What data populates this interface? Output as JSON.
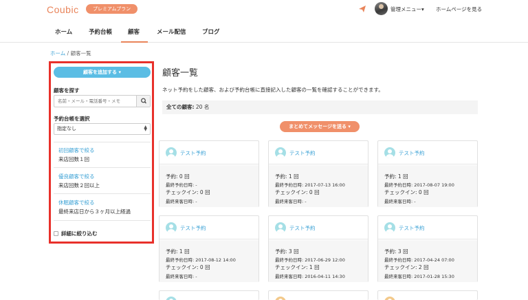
{
  "header": {
    "logo": "Coubic",
    "premium_badge": "プレミアムプラン",
    "admin_menu": "管理メニュー▾",
    "homepage_link": "ホームページを見る"
  },
  "nav": {
    "items": [
      "ホーム",
      "予約台帳",
      "顧客",
      "メール配信",
      "ブログ"
    ],
    "active": "顧客"
  },
  "breadcrumb": {
    "home": "ホーム",
    "separator": "/",
    "current": "顧客一覧"
  },
  "sidebar": {
    "add_button": "顧客を追加する ▾",
    "search_label": "顧客を探す",
    "search_placeholder": "名前・メール・電話番号・メモ",
    "ledger_label": "予約台帳を選択",
    "ledger_selected": "指定なし",
    "filters": [
      {
        "link": "初回顧客で絞る",
        "desc": "来店回数１回"
      },
      {
        "link": "優良顧客で絞る",
        "desc": "来店回数２回以上"
      },
      {
        "link": "休眠顧客で絞る",
        "desc": "最終来店日から３ヶ月以上経過"
      }
    ],
    "detail_filter": "詳細に絞り込む"
  },
  "main": {
    "title": "顧客一覧",
    "description": "ネット予約をした顧客、および予約台帳に直接記入した顧客の一覧を確認することができます。",
    "total_label": "全ての顧客:",
    "total_value": "20 名",
    "message_button": "まとめてメッセージを送る ▾"
  },
  "cards": [
    {
      "name": "テスト予約",
      "reservations": "予約: 0 回",
      "last_reservation": "最終予約日時: -",
      "checkins": "チェックイン: 0 回",
      "last_visit": "最終来客日時: -"
    },
    {
      "name": "テスト予約",
      "reservations": "予約: 1 回",
      "last_reservation": "最終予約日時: 2017-07-13 16:00",
      "checkins": "チェックイン: 0 回",
      "last_visit": "最終来客日時: -"
    },
    {
      "name": "テスト予約",
      "reservations": "予約: 1 回",
      "last_reservation": "最終予約日時: 2017-08-07 19:00",
      "checkins": "チェックイン: 0 回",
      "last_visit": "最終来客日時: -"
    },
    {
      "name": "テスト予約",
      "reservations": "予約: 1 回",
      "last_reservation": "最終予約日時: 2017-08-12 14:00",
      "checkins": "チェックイン: 0 回",
      "last_visit": "最終来客日時: -"
    },
    {
      "name": "テスト予約",
      "reservations": "予約: 3 回",
      "last_reservation": "最終予約日時: 2017-06-29 12:00",
      "checkins": "チェックイン: 1 回",
      "last_visit": "最終来客日時: 2016-04-11 14:30"
    },
    {
      "name": "テスト予約",
      "reservations": "予約: 3 回",
      "last_reservation": "最終予約日時: 2017-04-24 07:00",
      "checkins": "チェックイン: 2 回",
      "last_visit": "最終来客日時: 2017-01-28 15:30"
    }
  ],
  "colors": {
    "brand_orange": "#e9845a",
    "accent_blue": "#5bbde4",
    "link_blue": "#3aa1d5",
    "highlight_red": "#e8302a"
  }
}
